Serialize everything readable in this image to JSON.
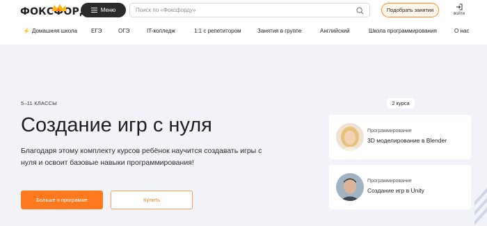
{
  "header": {
    "logo_text": "ФОКСФОРД",
    "menu_label": "Меню",
    "search_placeholder": "Поиск по «Фоксфорду»",
    "cta_label": "Подобрать занятия",
    "login_label": "войти"
  },
  "nav": {
    "items": [
      {
        "label": "Домашняя школа"
      },
      {
        "label": "ЕГЭ"
      },
      {
        "label": "ОГЭ"
      },
      {
        "label": "IT-колледж"
      },
      {
        "label": "1:1 с репетитором"
      },
      {
        "label": "Занятия в группе"
      },
      {
        "label": "Английский"
      },
      {
        "label": "Школа программирования"
      },
      {
        "label": "О нас"
      }
    ]
  },
  "hero": {
    "grade": "5–11 КЛАССЫ",
    "title": "Создание игр с нуля",
    "description": "Благодаря этому комплекту курсов ребёнок научится создавать игры с нуля и освоит базовые навыки программирования!",
    "primary_button": "Больше о программе",
    "secondary_button": "Купить"
  },
  "courses": {
    "count_label": "2 курса",
    "items": [
      {
        "category": "Программирование",
        "name": "3D моделирование в Blender"
      },
      {
        "category": "Программирование",
        "name": "Создание игр в Unity"
      }
    ]
  },
  "colors": {
    "accent": "#ff7a1f",
    "dark": "#2b2b2b",
    "background": "#f2f3f8"
  },
  "icons": [
    "fox-hat-logo-icon",
    "menu-icon",
    "search-icon",
    "login-icon",
    "bolt-icon"
  ]
}
